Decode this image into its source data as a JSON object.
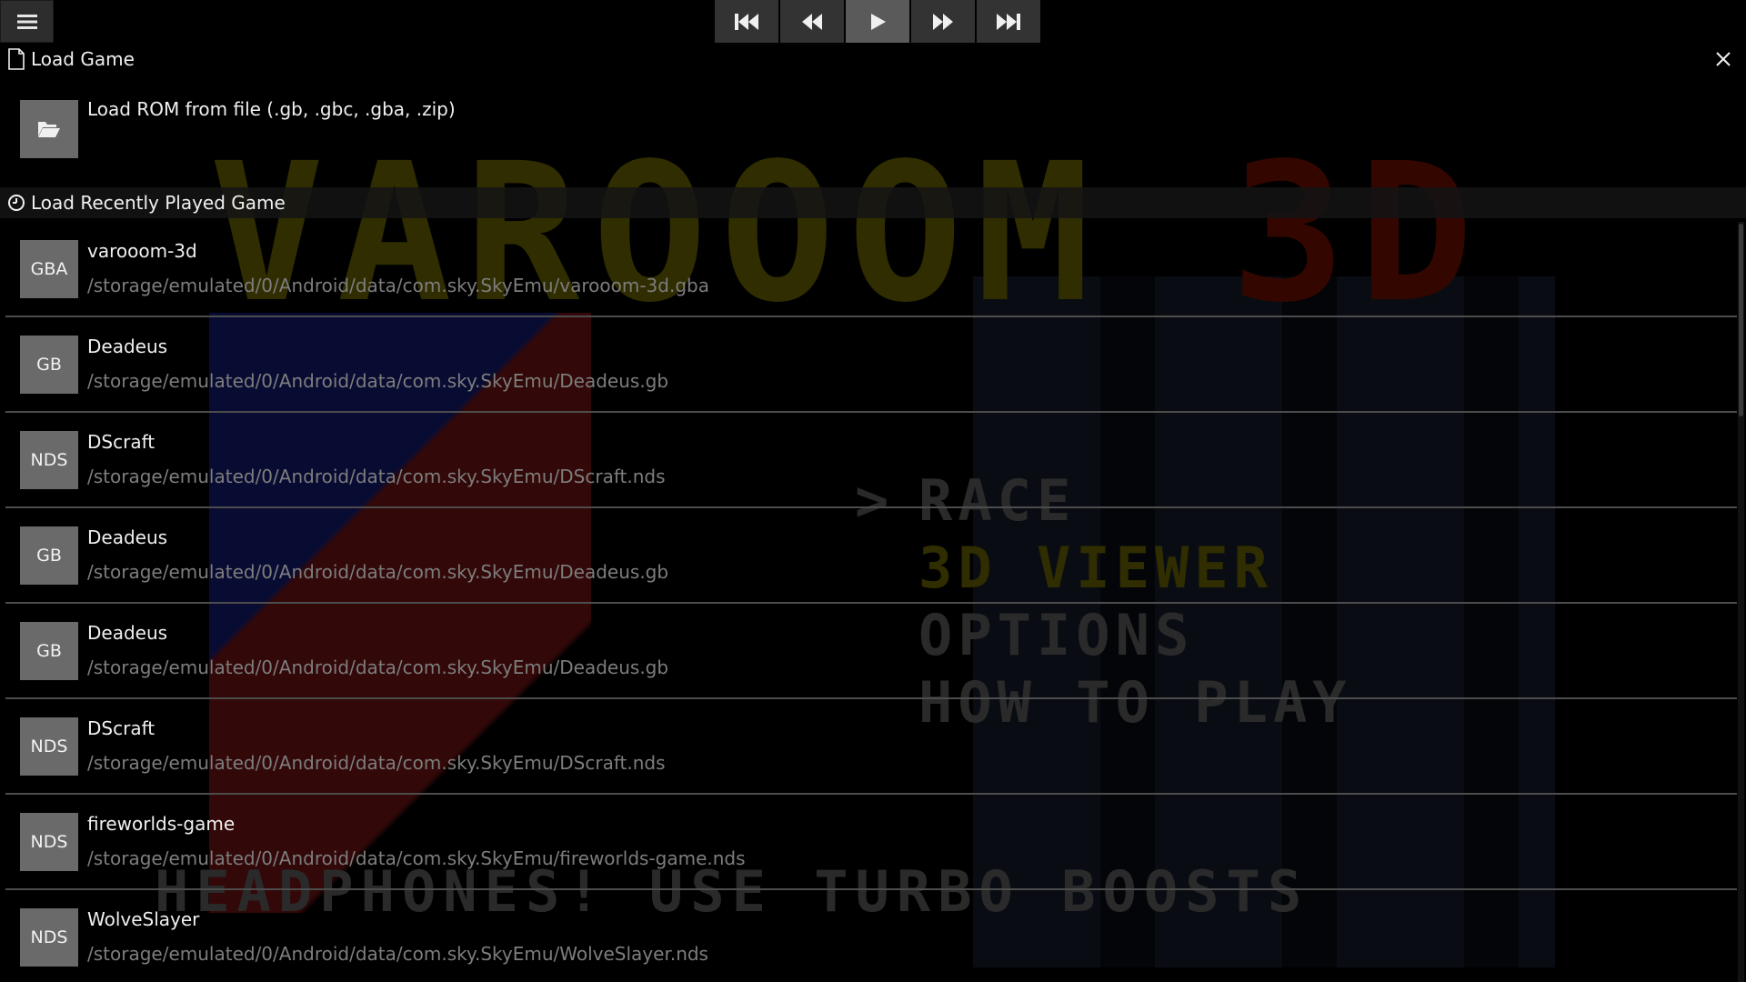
{
  "game_screen": {
    "title_main": "VAROOOM",
    "title_accent": "3D",
    "menu_cursor": ">",
    "menu_items": [
      "RACE",
      "3D VIEWER",
      "OPTIONS",
      "HOW TO PLAY"
    ],
    "ticker": "HEADPHONES!        USE TURBO BOOSTS"
  },
  "toolbar": {
    "menu_icon": "hamburger-icon",
    "transport": [
      {
        "name": "skip-back-button",
        "icon": "skip-back-icon"
      },
      {
        "name": "rewind-button",
        "icon": "rewind-icon"
      },
      {
        "name": "play-button",
        "icon": "play-icon",
        "active": true
      },
      {
        "name": "fast-forward-button",
        "icon": "fast-forward-icon"
      },
      {
        "name": "skip-forward-button",
        "icon": "skip-forward-icon"
      }
    ]
  },
  "load_game": {
    "header": "Load Game",
    "load_rom_label": "Load ROM from file (.gb, .gbc, .gba, .zip)"
  },
  "recent": {
    "header": "Load Recently Played Game",
    "items": [
      {
        "badge": "GBA",
        "name": "varooom-3d",
        "path": "/storage/emulated/0/Android/data/com.sky.SkyEmu/varooom-3d.gba"
      },
      {
        "badge": "GB",
        "name": "Deadeus",
        "path": "/storage/emulated/0/Android/data/com.sky.SkyEmu/Deadeus.gb"
      },
      {
        "badge": "NDS",
        "name": "DScraft",
        "path": "/storage/emulated/0/Android/data/com.sky.SkyEmu/DScraft.nds"
      },
      {
        "badge": "GB",
        "name": "Deadeus",
        "path": "/storage/emulated/0/Android/data/com.sky.SkyEmu/Deadeus.gb"
      },
      {
        "badge": "GB",
        "name": "Deadeus",
        "path": "/storage/emulated/0/Android/data/com.sky.SkyEmu/Deadeus.gb"
      },
      {
        "badge": "NDS",
        "name": "DScraft",
        "path": "/storage/emulated/0/Android/data/com.sky.SkyEmu/DScraft.nds"
      },
      {
        "badge": "NDS",
        "name": "fireworlds-game",
        "path": "/storage/emulated/0/Android/data/com.sky.SkyEmu/fireworlds-game.nds"
      },
      {
        "badge": "NDS",
        "name": "WolveSlayer",
        "path": "/storage/emulated/0/Android/data/com.sky.SkyEmu/WolveSlayer.nds"
      }
    ]
  },
  "colors": {
    "background": "#000000",
    "button": "#333333",
    "button_active": "#5a5a5a",
    "badge": "#6a6a6a",
    "path_text": "#7d7d7d"
  }
}
